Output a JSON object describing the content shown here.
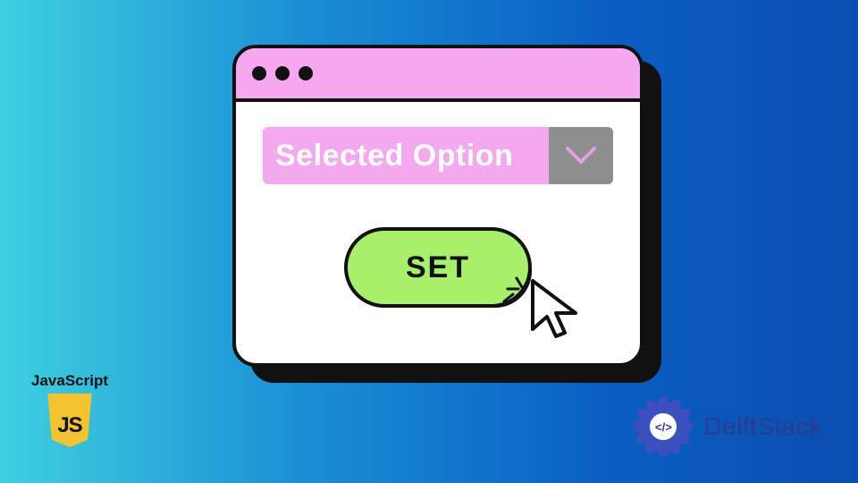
{
  "window": {
    "dots": 3
  },
  "select": {
    "value": "Selected Option"
  },
  "button": {
    "label": "SET"
  },
  "js_badge": {
    "label": "JavaScript",
    "shield_text": "JS"
  },
  "brand": {
    "name": "DelftStack",
    "center_glyph": "</>"
  },
  "icons": {
    "chevron": "chevron-down-icon",
    "cursor": "cursor-pointer-icon"
  }
}
